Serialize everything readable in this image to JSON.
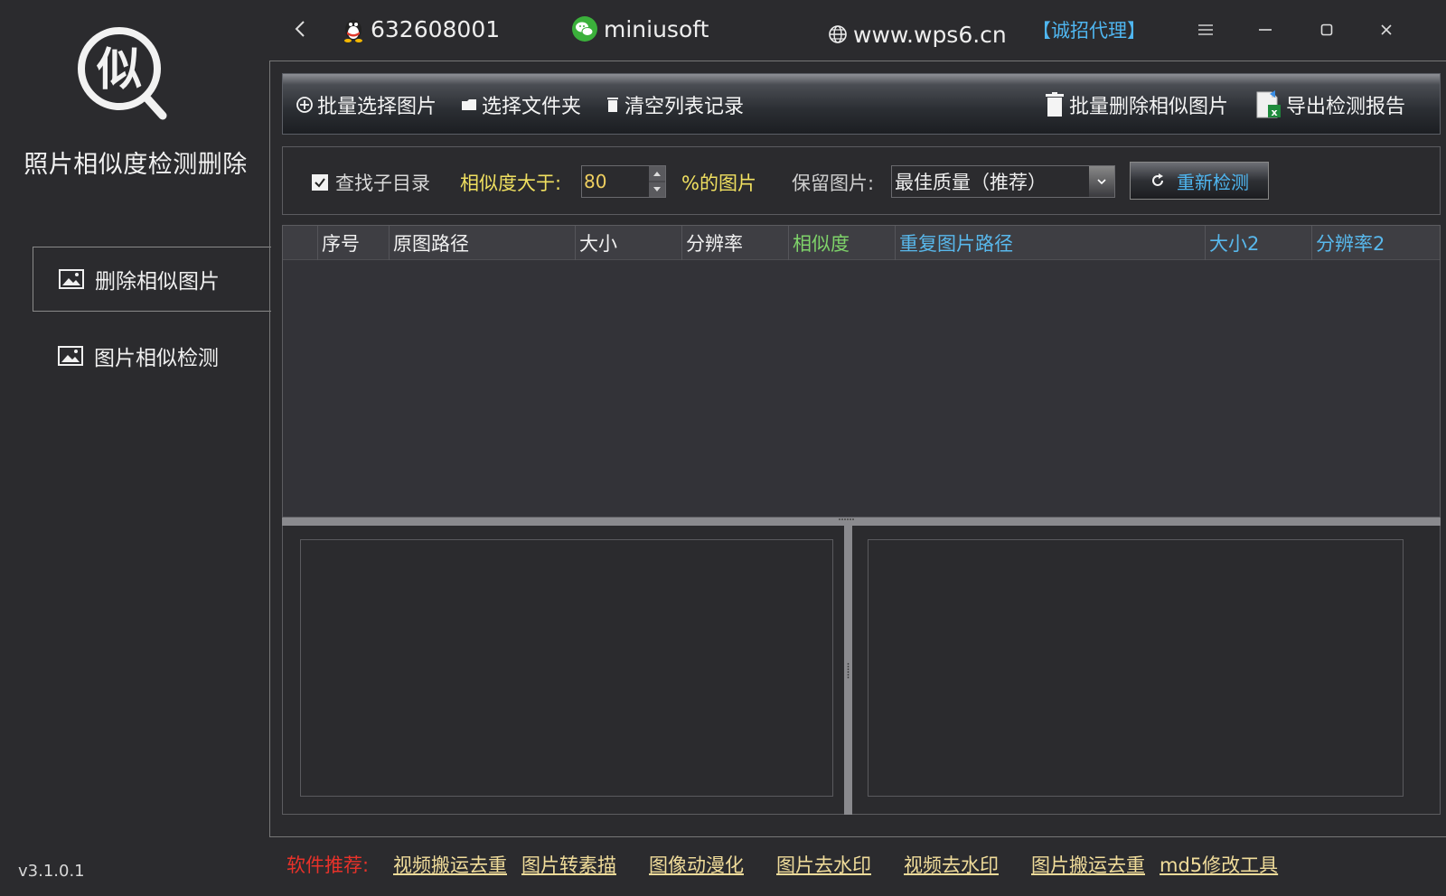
{
  "sidebar": {
    "logo_char": "似",
    "app_title": "照片相似度检测删除",
    "items": [
      {
        "label": "删除相似图片",
        "active": true
      },
      {
        "label": "图片相似检测",
        "active": false
      }
    ],
    "version": "v3.1.0.1"
  },
  "titlebar": {
    "qq_number": "632608001",
    "wechat_id": "miniusoft",
    "website": "www.wps6.cn",
    "agent_link": "【诚招代理】"
  },
  "toolbar": {
    "batch_select": "批量选择图片",
    "select_folder": "选择文件夹",
    "clear_list": "清空列表记录",
    "batch_delete": "批量删除相似图片",
    "export_report": "导出检测报告"
  },
  "options": {
    "search_subdir_label": "查找子目录",
    "search_subdir_checked": true,
    "similarity_label": "相似度大于:",
    "similarity_value": "80",
    "similarity_suffix": "%的图片",
    "keep_label": "保留图片:",
    "keep_selected": "最佳质量（推荐）",
    "redetect_label": "重新检测"
  },
  "table": {
    "columns": [
      "序号",
      "原图路径",
      "大小",
      "分辨率",
      "相似度",
      "重复图片路径",
      "大小2",
      "分辨率2"
    ],
    "rows": []
  },
  "footer": {
    "recommend_label": "软件推荐:",
    "links": [
      "视频搬运去重",
      "图片转素描",
      "图像动漫化",
      "图片去水印",
      "视频去水印",
      "图片搬运去重",
      "md5修改工具"
    ]
  },
  "colors": {
    "background": "#2b2b2e",
    "yellow_label": "#f0e060",
    "green_header": "#7fd46a",
    "blue_header": "#58b8ec",
    "recommend_red": "#e8322a"
  }
}
